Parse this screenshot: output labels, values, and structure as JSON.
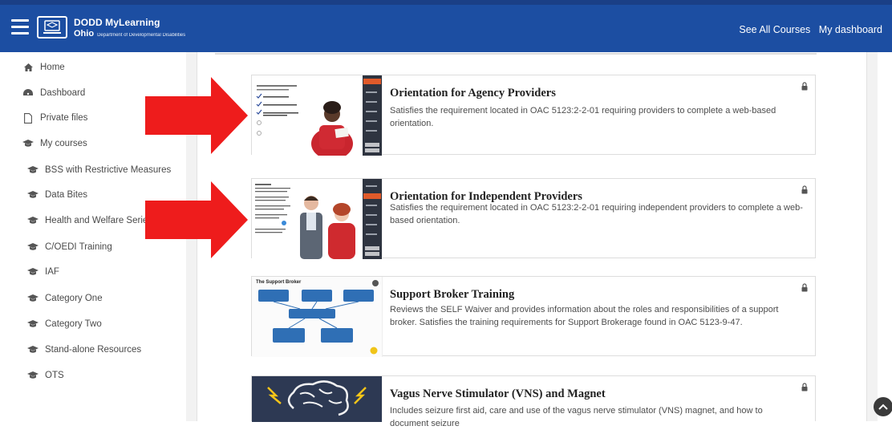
{
  "navbar": {
    "brand_title": "DODD MyLearning",
    "brand_state": "Ohio",
    "brand_dept": "Department of Developmental Disabilities",
    "links": [
      "See All Courses",
      "My dashboard"
    ]
  },
  "sidebar": {
    "items": [
      {
        "label": "Home",
        "icon": "home-icon"
      },
      {
        "label": "Dashboard",
        "icon": "dashboard-icon"
      },
      {
        "label": "Private files",
        "icon": "file-icon"
      },
      {
        "label": "My courses",
        "icon": "graduation-cap-icon"
      },
      {
        "label": "BSS with Restrictive Measures",
        "icon": "graduation-cap-icon"
      },
      {
        "label": "Data Bites",
        "icon": "graduation-cap-icon"
      },
      {
        "label": "Health and Welfare Series",
        "icon": "graduation-cap-icon"
      },
      {
        "label": "C/OEDI Training",
        "icon": "graduation-cap-icon"
      },
      {
        "label": "IAF",
        "icon": "graduation-cap-icon"
      },
      {
        "label": "Category One",
        "icon": "graduation-cap-icon"
      },
      {
        "label": "Category Two",
        "icon": "graduation-cap-icon"
      },
      {
        "label": "Stand-alone Resources",
        "icon": "graduation-cap-icon"
      },
      {
        "label": "OTS",
        "icon": "graduation-cap-icon"
      }
    ]
  },
  "courses": [
    {
      "title": "Orientation for Agency Providers",
      "description": "Satisfies the requirement located in OAC 5123:2-2-01 requiring providers to complete a web-based orientation.",
      "thumb_heading": "Certification Requirements"
    },
    {
      "title": "Orientation for Independent Providers",
      "description": "Satisfies the requirement located in OAC 5123:2-2-01 requiring independent providers to complete a web-based orientation.",
      "thumb_heading": "Insurance"
    },
    {
      "title": "Support Broker Training",
      "description": "Reviews the SELF Waiver and provides information about the roles and responsibilities of a support broker. Satisfies the training requirements for Support Brokerage found in OAC 5123-9-47.",
      "thumb_heading": "The Support Broker"
    },
    {
      "title": "Vagus Nerve Stimulator (VNS) and Magnet",
      "description": "Includes seizure first aid, care and use of the vagus nerve stimulator (VNS) magnet, and how to document seizure"
    }
  ],
  "colors": {
    "navbar": "#1c4ea2",
    "arrow": "#ee1c1c",
    "sidebar_text": "#4a4a4a"
  }
}
